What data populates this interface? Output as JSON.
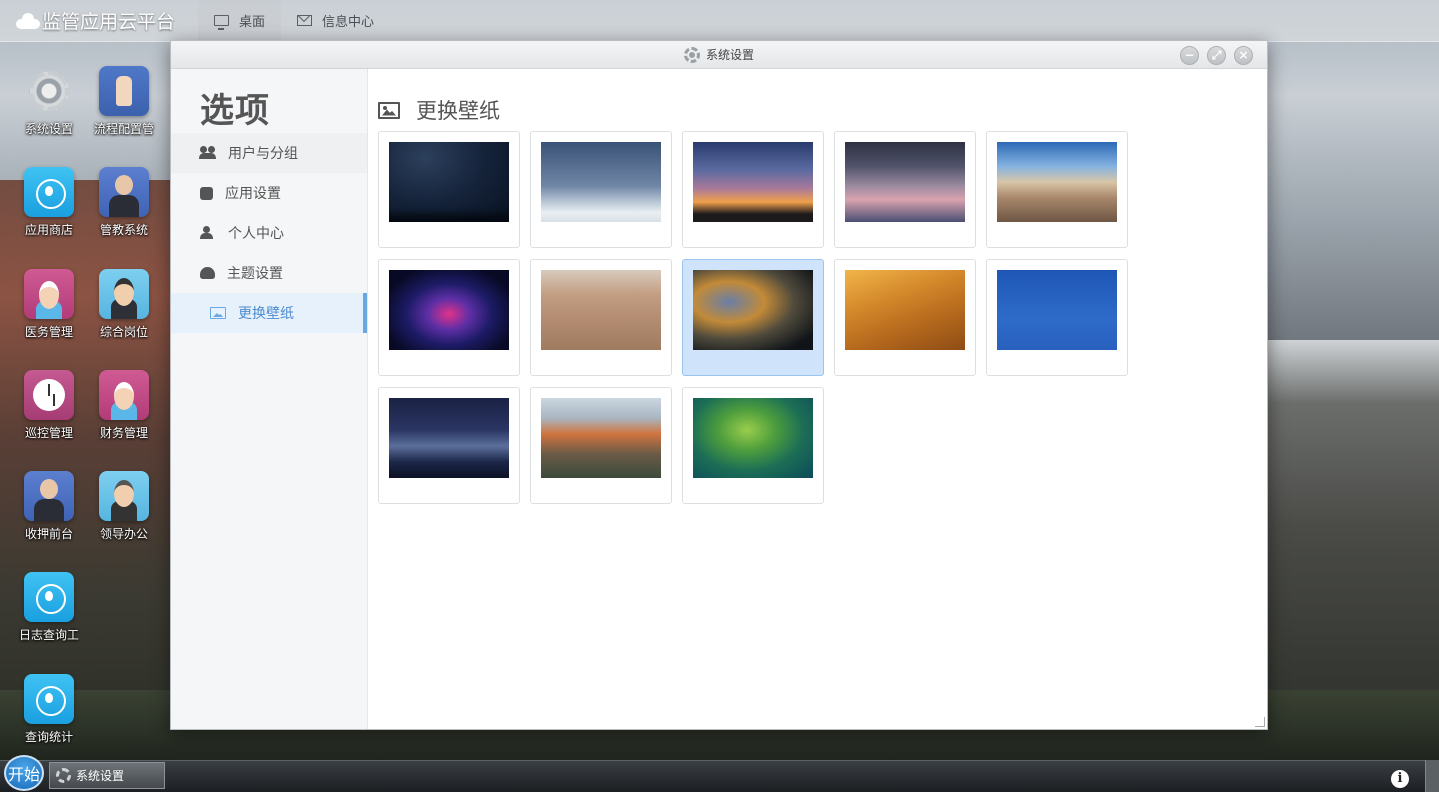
{
  "topbar": {
    "brand": "监管应用云平台",
    "tabs": [
      {
        "label": "桌面",
        "icon": "monitor-icon",
        "active": true
      },
      {
        "label": "信息中心",
        "icon": "mail-icon",
        "active": false
      }
    ]
  },
  "desktop": {
    "icons": [
      {
        "label": "系统设置",
        "icon": "gear-icon"
      },
      {
        "label": "流程配置管",
        "icon": "bible-hand-icon"
      },
      {
        "label": "应用商店",
        "icon": "app-store-icon"
      },
      {
        "label": "管教系统",
        "icon": "officer-icon"
      },
      {
        "label": "医务管理",
        "icon": "nurse-icon"
      },
      {
        "label": "综合岗位",
        "icon": "police-officer-icon"
      },
      {
        "label": "巡控管理",
        "icon": "clock-icon"
      },
      {
        "label": "财务管理",
        "icon": "nurse-icon"
      },
      {
        "label": "收押前台",
        "icon": "suited-man-icon"
      },
      {
        "label": "领导办公",
        "icon": "leader-icon"
      },
      {
        "label": "日志查询工",
        "icon": "app-store-icon"
      },
      {
        "label": "查询统计",
        "icon": "app-store-icon"
      }
    ]
  },
  "window": {
    "title": "系统设置",
    "controls": [
      "minimize",
      "maximize",
      "close"
    ],
    "sidebar": {
      "title": "选项",
      "items": [
        {
          "label": "用户与分组",
          "icon": "users-icon"
        },
        {
          "label": "应用设置",
          "icon": "phone-icon"
        },
        {
          "label": "个人中心",
          "icon": "person-icon"
        },
        {
          "label": "主题设置",
          "icon": "palette-icon"
        },
        {
          "label": "更换壁纸",
          "icon": "image-icon",
          "active": true
        }
      ]
    },
    "content": {
      "heading": "更换壁纸",
      "wallpapers": [
        {
          "id": 1,
          "desc": "starry night"
        },
        {
          "id": 2,
          "desc": "clouds sky"
        },
        {
          "id": 3,
          "desc": "sunset tree"
        },
        {
          "id": 4,
          "desc": "dusk power lines"
        },
        {
          "id": 5,
          "desc": "hay bale field"
        },
        {
          "id": 6,
          "desc": "purple light streaks"
        },
        {
          "id": 7,
          "desc": "beach shell"
        },
        {
          "id": 8,
          "desc": "blurred bokeh",
          "selected": true
        },
        {
          "id": 9,
          "desc": "desert dunes"
        },
        {
          "id": 10,
          "desc": "blue sky roof"
        },
        {
          "id": 11,
          "desc": "night mountains"
        },
        {
          "id": 12,
          "desc": "el capitan"
        },
        {
          "id": 13,
          "desc": "green aurora"
        }
      ]
    }
  },
  "taskbar": {
    "start_label": "开始",
    "items": [
      {
        "label": "系统设置",
        "icon": "gear-icon"
      }
    ],
    "info_label": "i"
  }
}
